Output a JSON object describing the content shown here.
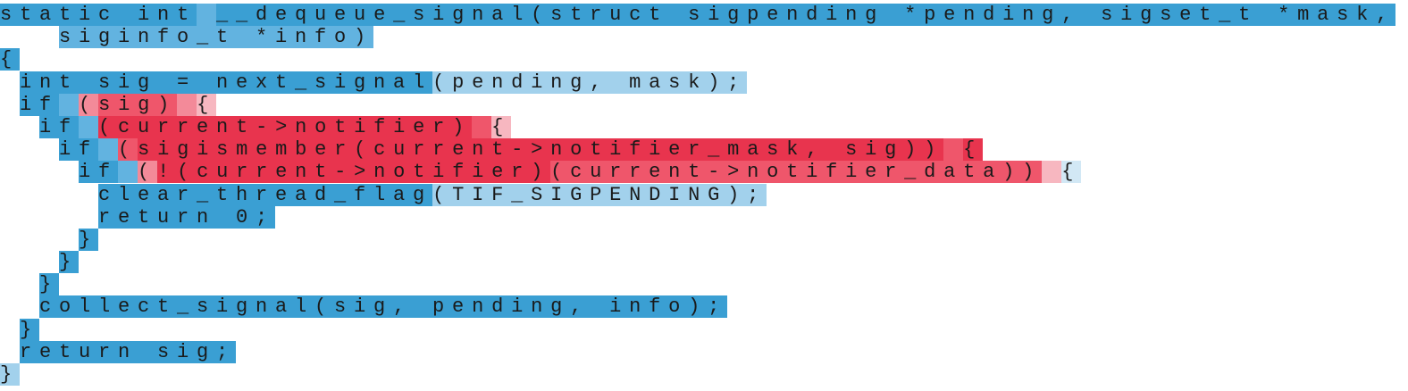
{
  "palette": {
    "blue_dark": "#3a9fd3",
    "blue_mid": "#62b3e0",
    "blue_light": "#a2d1ec",
    "blue_pale": "#d2e8f5",
    "red_dark": "#e8344e",
    "red_mid": "#ef566b",
    "red_light": "#f38a99",
    "red_pale": "#f7b7c0"
  },
  "lines": [
    {
      "indent": "",
      "tokens": [
        {
          "text": "static int",
          "c": "blue_dark"
        },
        {
          "text": " ",
          "c": "blue_mid"
        },
        {
          "text": "__dequeue_signal",
          "c": "blue_dark"
        },
        {
          "text": "(struct sigpending *pending, sigset_t *mask,",
          "c": "blue_dark"
        }
      ]
    },
    {
      "indent": "   ",
      "tokens": [
        {
          "text": "siginfo_t *info)",
          "c": "blue_mid"
        }
      ]
    },
    {
      "indent": "",
      "tokens": [
        {
          "text": "{",
          "c": "blue_dark"
        }
      ]
    },
    {
      "indent": " ",
      "tokens": [
        {
          "text": "int sig = next_signal",
          "c": "blue_dark"
        },
        {
          "text": "(pending, ",
          "c": "blue_light"
        },
        {
          "text": "mask);",
          "c": "blue_light"
        }
      ]
    },
    {
      "indent": " ",
      "tokens": [
        {
          "text": "if",
          "c": "blue_dark"
        },
        {
          "text": " ",
          "c": "blue_mid"
        },
        {
          "text": "(",
          "c": "red_light"
        },
        {
          "text": "sig)",
          "c": "red_mid"
        },
        {
          "text": " ",
          "c": "red_light"
        },
        {
          "text": "{",
          "c": "red_pale"
        }
      ]
    },
    {
      "indent": "  ",
      "tokens": [
        {
          "text": "if",
          "c": "blue_dark"
        },
        {
          "text": " ",
          "c": "blue_mid"
        },
        {
          "text": "(current->notifier)",
          "c": "red_dark"
        },
        {
          "text": " ",
          "c": "red_mid"
        },
        {
          "text": "{",
          "c": "red_pale"
        }
      ]
    },
    {
      "indent": "   ",
      "tokens": [
        {
          "text": "if",
          "c": "blue_dark"
        },
        {
          "text": " ",
          "c": "blue_mid"
        },
        {
          "text": "(",
          "c": "red_mid"
        },
        {
          "text": "sigismember(current->notifier_mask, sig))",
          "c": "red_dark"
        },
        {
          "text": " ",
          "c": "red_mid"
        },
        {
          "text": "{",
          "c": "red_dark"
        }
      ]
    },
    {
      "indent": "    ",
      "tokens": [
        {
          "text": "if",
          "c": "blue_dark"
        },
        {
          "text": " ",
          "c": "blue_mid"
        },
        {
          "text": "(",
          "c": "red_light"
        },
        {
          "text": "!(current->notifier)",
          "c": "red_dark"
        },
        {
          "text": "(current->notifier_data))",
          "c": "red_mid"
        },
        {
          "text": " ",
          "c": "red_pale"
        },
        {
          "text": "{",
          "c": "blue_pale"
        }
      ]
    },
    {
      "indent": "     ",
      "tokens": [
        {
          "text": "clear_thread_flag",
          "c": "blue_dark"
        },
        {
          "text": "(TIF_SIGPENDING);",
          "c": "blue_light"
        }
      ]
    },
    {
      "indent": "     ",
      "tokens": [
        {
          "text": "return 0;",
          "c": "blue_dark"
        }
      ]
    },
    {
      "indent": "    ",
      "tokens": [
        {
          "text": "}",
          "c": "blue_dark"
        }
      ]
    },
    {
      "indent": "   ",
      "tokens": [
        {
          "text": "}",
          "c": "blue_dark"
        }
      ]
    },
    {
      "indent": "  ",
      "tokens": [
        {
          "text": "}",
          "c": "blue_dark"
        }
      ]
    },
    {
      "indent": "  ",
      "tokens": [
        {
          "text": "collect_signal(sig, pending, info);",
          "c": "blue_dark"
        }
      ]
    },
    {
      "indent": " ",
      "tokens": [
        {
          "text": "}",
          "c": "blue_dark"
        }
      ]
    },
    {
      "indent": " ",
      "tokens": [
        {
          "text": "return sig;",
          "c": "blue_dark"
        }
      ]
    },
    {
      "indent": "",
      "tokens": [
        {
          "text": "}",
          "c": "blue_light"
        }
      ]
    }
  ]
}
